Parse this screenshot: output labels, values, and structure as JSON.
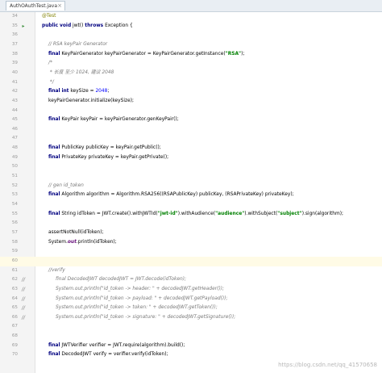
{
  "editor": {
    "tab": {
      "label": "AuthOAuthTest.java"
    },
    "watermark": "https://blog.csdn.net/qq_41570658"
  },
  "lines": [
    {
      "num": "34",
      "mark": "",
      "text": "@Test",
      "style": "an"
    },
    {
      "num": "35",
      "mark": "run",
      "text": "public void jwt() throws Exception {",
      "style": ""
    },
    {
      "num": "36",
      "mark": "",
      "text": "",
      "style": ""
    },
    {
      "num": "37",
      "mark": "",
      "text": "// RSA keyPair Generator",
      "style": "cm"
    },
    {
      "num": "38",
      "mark": "",
      "text": "final KeyPairGenerator keyPairGenerator = KeyPairGenerator.getInstance(\"RSA\");",
      "style": ""
    },
    {
      "num": "39",
      "mark": "",
      "text": "/*",
      "style": "cm"
    },
    {
      "num": "40",
      "mark": "",
      "text": " * 长度 至少 1024, 建议 2048",
      "style": "cm"
    },
    {
      "num": "41",
      "mark": "",
      "text": " */",
      "style": "cm"
    },
    {
      "num": "42",
      "mark": "",
      "text": "final int keySize = 2048;",
      "style": ""
    },
    {
      "num": "43",
      "mark": "",
      "text": "keyPairGenerator.initialize(keySize);",
      "style": ""
    },
    {
      "num": "44",
      "mark": "",
      "text": "",
      "style": ""
    },
    {
      "num": "45",
      "mark": "",
      "text": "final KeyPair keyPair = keyPairGenerator.genKeyPair();",
      "style": ""
    },
    {
      "num": "46",
      "mark": "",
      "text": "",
      "style": ""
    },
    {
      "num": "47",
      "mark": "",
      "text": "",
      "style": ""
    },
    {
      "num": "48",
      "mark": "",
      "text": "final PublicKey publicKey = keyPair.getPublic();",
      "style": ""
    },
    {
      "num": "49",
      "mark": "",
      "text": "final PrivateKey privateKey = keyPair.getPrivate();",
      "style": ""
    },
    {
      "num": "50",
      "mark": "",
      "text": "",
      "style": ""
    },
    {
      "num": "51",
      "mark": "",
      "text": "",
      "style": ""
    },
    {
      "num": "52",
      "mark": "",
      "text": "// gen id_token",
      "style": "cm"
    },
    {
      "num": "53",
      "mark": "",
      "text": "final Algorithm algorithm = Algorithm.RSA256((RSAPublicKey) publicKey, (RSAPrivateKey) privateKey);",
      "style": ""
    },
    {
      "num": "54",
      "mark": "",
      "text": "",
      "style": ""
    },
    {
      "num": "55",
      "mark": "",
      "text": "final String idToken = JWT.create().withJWTId(\"jwt-id\").withAudience(\"audience\").withSubject(\"subject\").sign(algorithm);",
      "style": ""
    },
    {
      "num": "56",
      "mark": "",
      "text": "",
      "style": ""
    },
    {
      "num": "57",
      "mark": "",
      "text": "assertNotNull(idToken);",
      "style": ""
    },
    {
      "num": "58",
      "mark": "",
      "text": "System.out.println(idToken);",
      "style": ""
    },
    {
      "num": "59",
      "mark": "",
      "text": "",
      "style": ""
    },
    {
      "num": "60",
      "mark": "",
      "text": "",
      "style": "cur"
    },
    {
      "num": "61",
      "mark": "",
      "text": "//verify",
      "style": "cm"
    },
    {
      "num": "62",
      "mark": "//",
      "text": "final DecodedJWT decodedJWT = JWT.decode(idToken);",
      "style": "cm"
    },
    {
      "num": "63",
      "mark": "//",
      "text": "System.out.println(\"id_token -> header: \" + decodedJWT.getHeader());",
      "style": "cm"
    },
    {
      "num": "64",
      "mark": "//",
      "text": "System.out.println(\"id_token -> payload: \" + decodedJWT.getPayload());",
      "style": "cm"
    },
    {
      "num": "65",
      "mark": "//",
      "text": "System.out.println(\"id_token -> token: \" + decodedJWT.getToken());",
      "style": "cm"
    },
    {
      "num": "66",
      "mark": "//",
      "text": "System.out.println(\"id_token -> signature: \" + decodedJWT.getSignature());",
      "style": "cm"
    },
    {
      "num": "67",
      "mark": "",
      "text": "",
      "style": ""
    },
    {
      "num": "68",
      "mark": "",
      "text": "",
      "style": ""
    },
    {
      "num": "69",
      "mark": "",
      "text": "final JWTVerifier verifier = JWT.require(algorithm).build();",
      "style": ""
    },
    {
      "num": "70",
      "mark": "",
      "text": "final DecodedJWT verify = verifier.verify(idToken);",
      "style": ""
    }
  ]
}
